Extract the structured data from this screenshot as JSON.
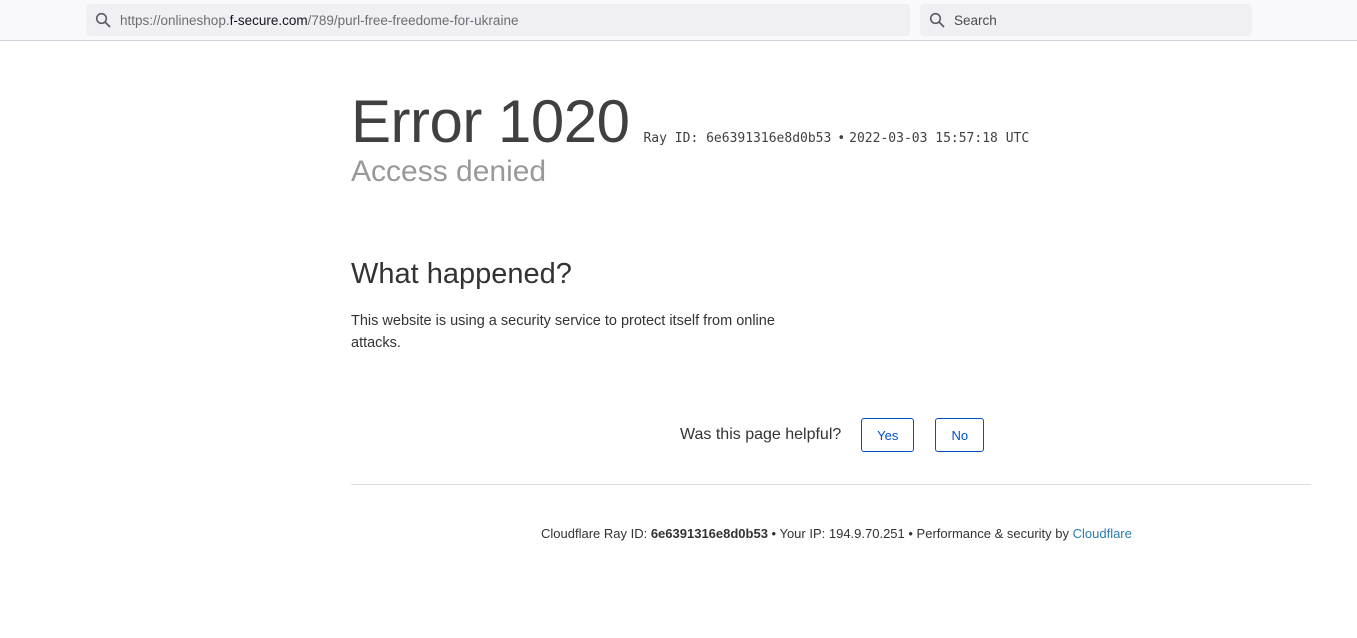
{
  "browser": {
    "url_prefix": "https://onlineshop.",
    "url_domain": "f-secure.com",
    "url_path": "/789/purl-free-freedome-for-ukraine",
    "search_placeholder": "Search"
  },
  "error": {
    "title": "Error 1020",
    "ray_label": "Ray ID: 6e6391316e8d0b53",
    "separator": "•",
    "timestamp": "2022-03-03 15:57:18 UTC",
    "subtitle": "Access denied"
  },
  "what_happened": {
    "heading": "What happened?",
    "text": "This website is using a security service to protect itself from online attacks."
  },
  "feedback": {
    "question": "Was this page helpful?",
    "yes_label": "Yes",
    "no_label": "No"
  },
  "footer": {
    "ray_label": "Cloudflare Ray ID: ",
    "ray_id": "6e6391316e8d0b53",
    "ip_text": " • Your IP: 194.9.70.251 • Performance & security by ",
    "cloudflare_link": "Cloudflare"
  },
  "colors": {
    "accent": "#0051c3",
    "link": "#2c7cb0"
  }
}
